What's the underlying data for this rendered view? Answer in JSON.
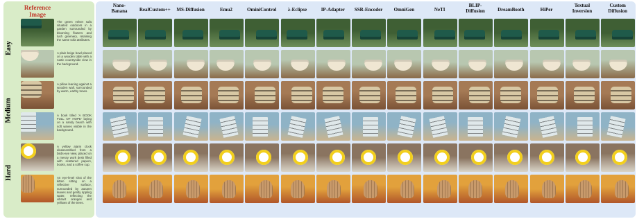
{
  "reference": {
    "title": "Reference Image",
    "rows": [
      {
        "difficulty": "Easy",
        "subject": "sofa",
        "caption": "The green velvet sofa situated outdoors in a garden surrounded by blooming flowers and lush greenery, retaining the same sofa attributes."
      },
      {
        "difficulty": "Easy",
        "subject": "bowl",
        "caption": "A plain beige bowl placed on a wooden table with a rustic countryside view in the background."
      },
      {
        "difficulty": "Medium",
        "subject": "pillow",
        "caption": "A pillow leaning against a wooden wall, surrounded by warm, earthy tones."
      },
      {
        "difficulty": "Medium",
        "subject": "book",
        "caption": "A book titled 'A BOOK FULL OF HOPE' laying on a sandy beach with soft waves visible in the background."
      },
      {
        "difficulty": "Hard",
        "subject": "clock",
        "caption": "A yellow alarm clock disassembled from a birds-eye view, placed on a messy work desk filled with scattered papers, books, and a coffee cup."
      },
      {
        "difficulty": "Hard",
        "subject": "kitten",
        "caption": "An eye-level shot of the kitten sitting on a reflective surface, surrounded by autumn leaves and gently rippling water, reflecting the vibrant oranges and yellows of the trees."
      }
    ]
  },
  "difficulties": [
    {
      "label": "Easy"
    },
    {
      "label": "Medium"
    },
    {
      "label": "Hard"
    }
  ],
  "methods": [
    {
      "line1": "Nano-",
      "line2": "Banana"
    },
    {
      "line1": "RealCustom++",
      "line2": ""
    },
    {
      "line1": "MS-Diffusion",
      "line2": ""
    },
    {
      "line1": "Emu2",
      "line2": ""
    },
    {
      "line1": "OminiControl",
      "line2": ""
    },
    {
      "line1": "λ-Eclipse",
      "line2": ""
    },
    {
      "line1": "IP-Adapter",
      "line2": ""
    },
    {
      "line1": "SSR-Encoder",
      "line2": ""
    },
    {
      "line1": "OmniGen",
      "line2": ""
    },
    {
      "line1": "NeTI",
      "line2": ""
    },
    {
      "line1": "BLIP-",
      "line2": "Diffusion"
    },
    {
      "line1": "DreamBooth",
      "line2": ""
    },
    {
      "line1": "HiPer",
      "line2": ""
    },
    {
      "line1": "Textual",
      "line2": "Inversion"
    },
    {
      "line1": "Custom",
      "line2": "Diffusion"
    }
  ],
  "palettes": {
    "sofa": {
      "bg": "#6f8f5a",
      "bg2": "#3f5f34",
      "obj": "#1f5a4a",
      "shape": "sofa"
    },
    "bowl": {
      "bg": "#8a6a48",
      "bg2": "#b8c7b0",
      "obj": "#efe6d2",
      "shape": "bowl"
    },
    "pillow": {
      "bg": "#7a5236",
      "bg2": "#a57a55",
      "obj": "#d8c8a4",
      "shape": "pillow"
    },
    "book": {
      "bg": "#c9b48f",
      "bg2": "#8fb3c6",
      "obj": "#dfe8ea",
      "shape": "book"
    },
    "clock": {
      "bg": "#d9d4c8",
      "bg2": "#8a7460",
      "obj": "#f2cf1d",
      "shape": "clock"
    },
    "kitten": {
      "bg": "#b0562a",
      "bg2": "#e2a13c",
      "obj": "#c89a6b",
      "shape": "kitten"
    }
  }
}
